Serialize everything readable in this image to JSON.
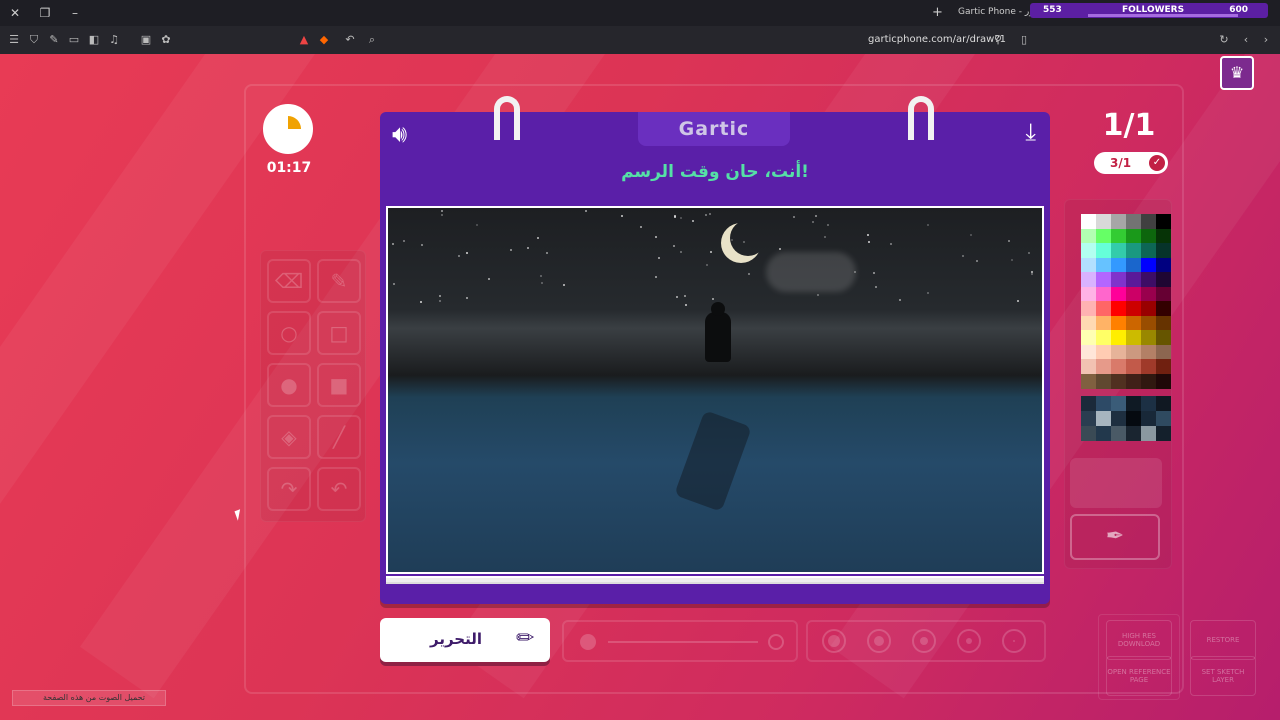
{
  "browser": {
    "tab_title": "Gartic Phone - التصور",
    "url": "garticphone.com/ar/draw?1",
    "followers_label": "FOLLOWERS",
    "followers_left": "553",
    "followers_right": "600"
  },
  "game": {
    "logo": "Gartic",
    "prompt": "أنت، حان وقت الرسم!",
    "timer": "01:17",
    "timer_fraction": 0.25,
    "round": "1/1",
    "done_count": "3/1",
    "done_button": "التحرير",
    "mini_buttons": {
      "high_res": "HIGH RES DOWNLOAD",
      "restore": "RESTORE",
      "open_ref": "OPEN REFERENCE PAGE",
      "sketch_layer": "SET SKETCH LAYER"
    },
    "bottom_note": "تحميل الصوت من هذه الصفحة"
  },
  "palette": {
    "colors": [
      "#ffffff",
      "#d9d9d9",
      "#a6a6a6",
      "#737373",
      "#404040",
      "#000000",
      "#b2ffb2",
      "#66ff66",
      "#33cc33",
      "#1a991a",
      "#0d660d",
      "#063306",
      "#b2fff0",
      "#66ffd9",
      "#33ccaa",
      "#1a9980",
      "#0d6655",
      "#06332a",
      "#b2e0ff",
      "#66c2ff",
      "#3399ff",
      "#1a66cc",
      "#0000ff",
      "#000080",
      "#d9b2ff",
      "#b366ff",
      "#8033cc",
      "#5a1a99",
      "#3d0d66",
      "#1f0633",
      "#ffb2e6",
      "#ff66cc",
      "#ff0099",
      "#cc0066",
      "#99004d",
      "#660033",
      "#ffb2b2",
      "#ff6666",
      "#ff0000",
      "#cc0000",
      "#990000",
      "#330000",
      "#ffd9b2",
      "#ffb366",
      "#ff8000",
      "#cc6600",
      "#994d00",
      "#663300",
      "#ffffb2",
      "#ffff66",
      "#ffee00",
      "#ccbb00",
      "#998800",
      "#665500",
      "#ffe6d9",
      "#ffccb3",
      "#e6b399",
      "#cc9980",
      "#b38066",
      "#8c6650",
      "#f2c2b2",
      "#e69a8a",
      "#d97a6a",
      "#c25a4a",
      "#a03a2a",
      "#702010",
      "#806040",
      "#604830",
      "#503020",
      "#402018",
      "#301810",
      "#200808"
    ],
    "recent": [
      "#1b2a3a",
      "#2d4a66",
      "#3a5c78",
      "#0f1a24",
      "#1c3044",
      "#101822",
      "#2a3d50",
      "#a7b5bf",
      "#1e2f40",
      "#050a10",
      "#182838",
      "#2f4a60",
      "#3a4a55",
      "#22384c",
      "#4a5a66",
      "#1a2530",
      "#8a98a0",
      "#14202c"
    ]
  },
  "icons": {
    "sound": "speaker-icon",
    "download": "download-icon",
    "avatar": "trophy-icon"
  }
}
